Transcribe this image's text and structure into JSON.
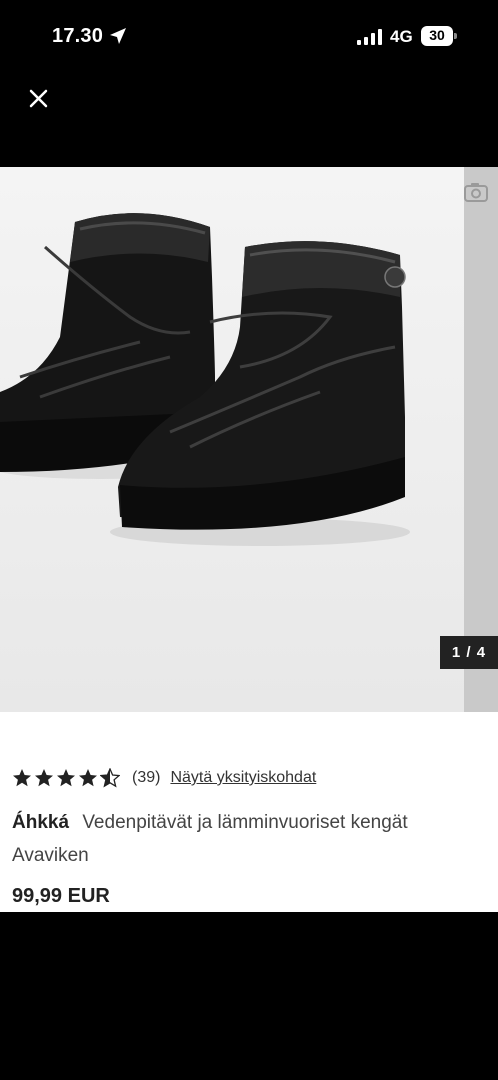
{
  "status_bar": {
    "time": "17.30",
    "network": "4G",
    "battery": "30"
  },
  "gallery": {
    "counter": "1 / 4"
  },
  "product": {
    "rating": 4.5,
    "review_count": "(39)",
    "details_link": "Näytä yksityiskohdat",
    "brand": "Áhkká",
    "name": "Vedenpitävät ja lämminvuoriset kengät",
    "subtitle": "Avaviken",
    "price": "99,99 EUR"
  },
  "colors": {
    "background_dark": "#000000",
    "text_primary": "#222222",
    "counter_bg": "#222222"
  },
  "icons": [
    "location-arrow-icon",
    "signal-icon",
    "battery-icon",
    "close-icon",
    "photo-icon",
    "star-icon",
    "half-star-icon"
  ]
}
